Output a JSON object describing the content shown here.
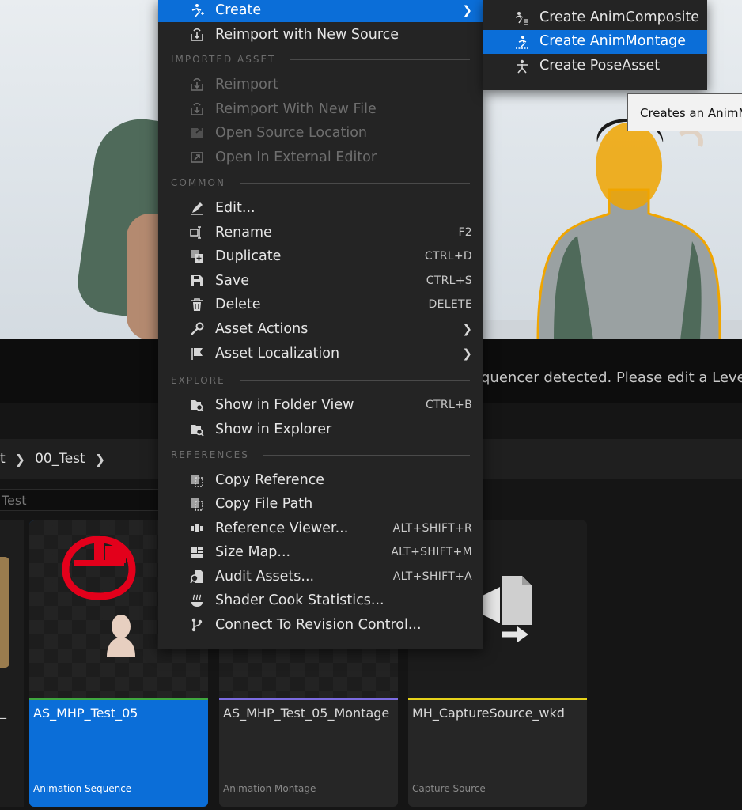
{
  "context_menu": {
    "items": [
      {
        "label": "Create",
        "icon": "create-anim-icon",
        "submenu": true,
        "highlighted": true
      },
      {
        "label": "Reimport with New Source",
        "icon": "reimport-icon"
      }
    ],
    "imported_asset": {
      "header": "IMPORTED ASSET",
      "items": [
        {
          "label": "Reimport",
          "icon": "reimport-icon",
          "disabled": true
        },
        {
          "label": "Reimport With New File",
          "icon": "reimport-icon",
          "disabled": true
        },
        {
          "label": "Open Source Location",
          "icon": "folder-open-icon",
          "disabled": true
        },
        {
          "label": "Open In External Editor",
          "icon": "external-editor-icon",
          "disabled": true
        }
      ]
    },
    "common": {
      "header": "COMMON",
      "items": [
        {
          "label": "Edit...",
          "icon": "pencil-icon",
          "shortcut": ""
        },
        {
          "label": "Rename",
          "icon": "rename-icon",
          "shortcut": "F2"
        },
        {
          "label": "Duplicate",
          "icon": "duplicate-icon",
          "shortcut": "CTRL+D"
        },
        {
          "label": "Save",
          "icon": "save-icon",
          "shortcut": "CTRL+S"
        },
        {
          "label": "Delete",
          "icon": "trash-icon",
          "shortcut": "DELETE"
        },
        {
          "label": "Asset Actions",
          "icon": "wrench-icon",
          "submenu": true
        },
        {
          "label": "Asset Localization",
          "icon": "flag-icon",
          "submenu": true
        }
      ]
    },
    "explore": {
      "header": "EXPLORE",
      "items": [
        {
          "label": "Show in Folder View",
          "icon": "folder-search-icon",
          "shortcut": "CTRL+B"
        },
        {
          "label": "Show in Explorer",
          "icon": "folder-search-icon",
          "shortcut": ""
        }
      ]
    },
    "references": {
      "header": "REFERENCES",
      "items": [
        {
          "label": "Copy Reference",
          "icon": "copy-icon",
          "shortcut": ""
        },
        {
          "label": "Copy File Path",
          "icon": "copy-icon",
          "shortcut": ""
        },
        {
          "label": "Reference Viewer...",
          "icon": "reference-viewer-icon",
          "shortcut": "ALT+SHIFT+R"
        },
        {
          "label": "Size Map...",
          "icon": "size-map-icon",
          "shortcut": "ALT+SHIFT+M"
        },
        {
          "label": "Audit Assets...",
          "icon": "audit-icon",
          "shortcut": "ALT+SHIFT+A"
        },
        {
          "label": "Shader Cook Statistics...",
          "icon": "shader-stats-icon",
          "shortcut": ""
        },
        {
          "label": "Connect To Revision Control...",
          "icon": "revision-control-icon",
          "shortcut": ""
        }
      ]
    }
  },
  "submenu": {
    "items": [
      {
        "label": "Create AnimComposite",
        "icon": "anim-composite-icon"
      },
      {
        "label": "Create AnimMontage",
        "icon": "anim-montage-icon",
        "highlighted": true
      },
      {
        "label": "Create PoseAsset",
        "icon": "pose-asset-icon"
      }
    ]
  },
  "tooltip": "Creates an AnimM",
  "viewport": {
    "status_message": "quencer detected. Please edit a Level Se"
  },
  "content_browser": {
    "breadcrumb": [
      "t",
      "00_Test"
    ],
    "filter_text": "Test",
    "left_partial_label": "_",
    "assets": [
      {
        "name": "AS_MHP_Test_05",
        "type": "Animation Sequence",
        "stripe_color": "#3fa73f",
        "selected": true
      },
      {
        "name": "AS_MHP_Test_05_Montage",
        "type": "Animation Montage",
        "stripe_color": "#7b6be0"
      },
      {
        "name": "MH_CaptureSource_wkd",
        "type": "Capture Source",
        "stripe_color": "#e6d21a"
      }
    ]
  },
  "colors": {
    "accent": "#0b6ed8",
    "menu_bg": "#242424",
    "selection_outline": "#f0a500"
  }
}
